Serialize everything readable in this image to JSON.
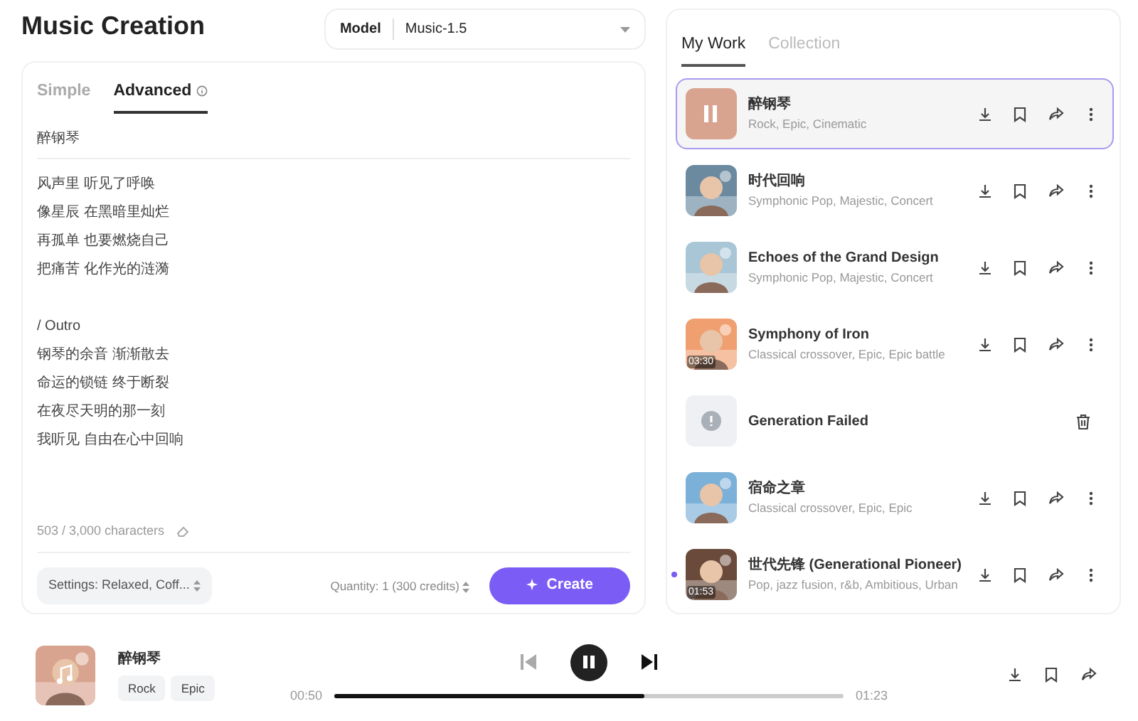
{
  "title": "Music Creation",
  "model": {
    "label": "Model",
    "value": "Music-1.5"
  },
  "mode_tabs": [
    {
      "label": "Simple",
      "selected": false
    },
    {
      "label": "Advanced",
      "selected": true,
      "info": true
    }
  ],
  "song_title": "醉钢琴",
  "lyric_stanzas": [
    [
      "风声里 听见了呼唤",
      "像星辰 在黑暗里灿烂",
      "再孤单 也要燃烧自己",
      "把痛苦 化作光的涟漪"
    ],
    [
      "/ Outro",
      "钢琴的余音 渐渐散去",
      "命运的锁链 终于断裂",
      "在夜尽天明的那一刻",
      "我听见 自由在心中回响"
    ]
  ],
  "char_count": "503 / 3,000 characters",
  "settings": "Settings: Relaxed, Coff...",
  "quantity": "Quantity: 1  (300 credits)",
  "create_button": "Create",
  "work_tabs": [
    {
      "label": "My Work",
      "selected": true
    },
    {
      "label": "Collection",
      "selected": false
    }
  ],
  "tracks": [
    {
      "kind": "song",
      "title": "醉钢琴",
      "tags": "Rock, Epic, Cinematic",
      "selected": true,
      "playing": true,
      "new": false
    },
    {
      "kind": "song",
      "title": "时代回响",
      "tags": "Symphonic Pop, Majestic, Concert",
      "selected": false,
      "playing": false,
      "new": false
    },
    {
      "kind": "song",
      "title": "Echoes of the Grand Design",
      "tags": "Symphonic Pop, Majestic, Concert",
      "selected": false,
      "playing": false,
      "new": false
    },
    {
      "kind": "song",
      "title": "Symphony of Iron",
      "tags": "Classical crossover, Epic, Epic battle",
      "duration": "03:30",
      "selected": false,
      "playing": false,
      "new": false
    },
    {
      "kind": "failed",
      "title": "Generation Failed"
    },
    {
      "kind": "song",
      "title": "宿命之章",
      "tags": "Classical crossover, Epic, Epic",
      "selected": false,
      "playing": false,
      "new": false
    },
    {
      "kind": "song",
      "title": "世代先锋 (Generational Pioneer)",
      "tags": "Pop, jazz fusion, r&b, Ambitious, Urban",
      "duration": "01:53",
      "selected": false,
      "playing": false,
      "new": true
    }
  ],
  "player": {
    "title": "醉钢琴",
    "tags": [
      "Rock",
      "Epic"
    ],
    "elapsed": "00:50",
    "total": "01:23",
    "level": 0.61,
    "playing": true,
    "prev_disabled": true
  }
}
